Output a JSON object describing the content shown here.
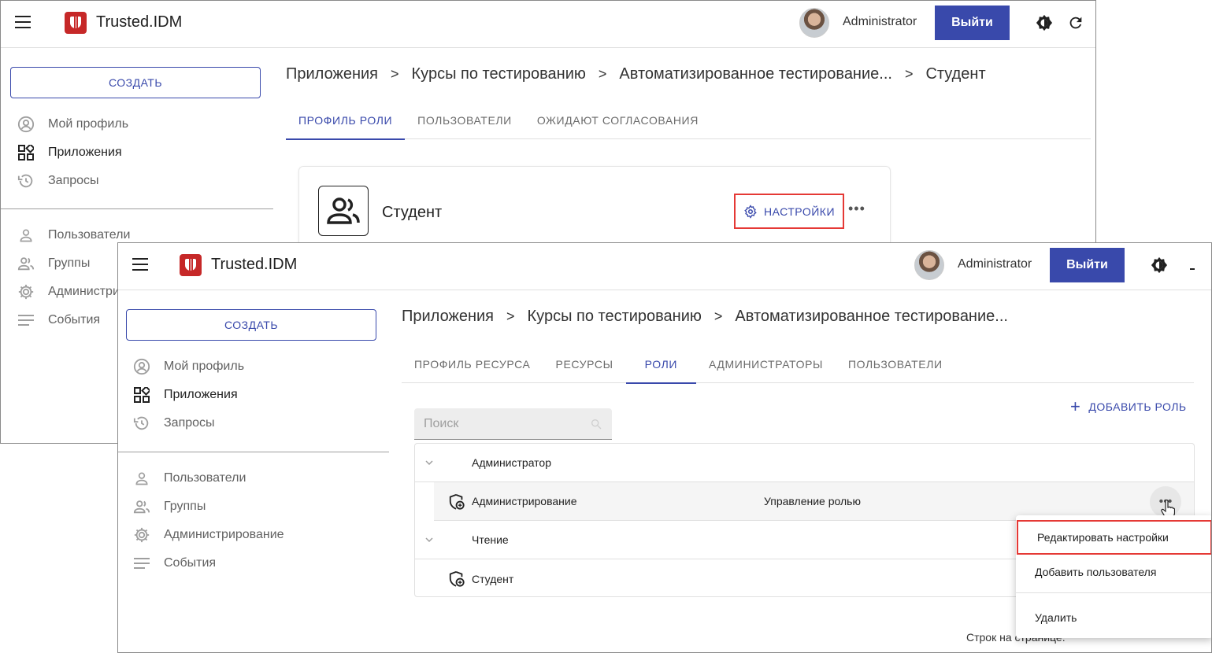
{
  "app": {
    "name": "Trusted.IDM",
    "user": "Administrator",
    "logout_label": "Выйти",
    "brand_color": "#c62828",
    "accent_color": "#3949ab"
  },
  "sidebar": {
    "create_label": "СОЗДАТЬ",
    "items": [
      {
        "label": "Мой профиль",
        "icon": "account-circle-icon"
      },
      {
        "label": "Приложения",
        "icon": "apps-grid-icon"
      },
      {
        "label": "Запросы",
        "icon": "history-icon"
      },
      {
        "label": "Пользователи",
        "icon": "person-icon"
      },
      {
        "label": "Группы",
        "icon": "group-icon"
      },
      {
        "label": "Администрирование",
        "icon": "gear-icon"
      },
      {
        "label": "События",
        "icon": "list-icon"
      }
    ]
  },
  "back": {
    "breadcrumbs": [
      "Приложения",
      "Курсы по тестированию",
      "Автоматизированное тестирование...",
      "Студент"
    ],
    "tabs": [
      "ПРОФИЛЬ РОЛИ",
      "ПОЛЬЗОВАТЕЛИ",
      "ОЖИДАЮТ СОГЛАСОВАНИЯ"
    ],
    "role_name": "Студент",
    "settings_label": "НАСТРОЙКИ"
  },
  "front": {
    "breadcrumbs": [
      "Приложения",
      "Курсы по тестированию",
      "Автоматизированное тестирование..."
    ],
    "tabs": [
      "ПРОФИЛЬ РЕСУРСА",
      "РЕСУРСЫ",
      "РОЛИ",
      "АДМИНИСТРАТОРЫ",
      "ПОЛЬЗОВАТЕЛИ"
    ],
    "search_placeholder": "Поиск",
    "add_role_label": "ДОБАВИТЬ РОЛЬ",
    "rows": [
      {
        "name": "Администратор",
        "description": ""
      },
      {
        "name": "Администрирование",
        "description": "Управление ролью"
      },
      {
        "name": "Чтение",
        "description": ""
      },
      {
        "name": "Студент",
        "description": ""
      }
    ],
    "menu": [
      "Редактировать настройки",
      "Добавить пользователя",
      "Удалить"
    ],
    "pager_label": "Строк на странице:"
  }
}
